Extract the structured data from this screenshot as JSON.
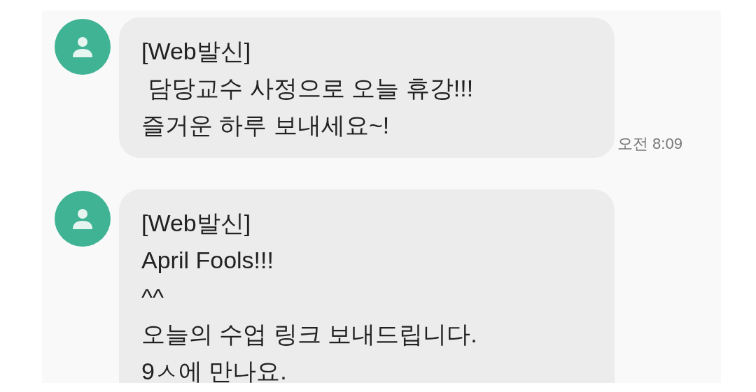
{
  "messages": [
    {
      "lines": [
        "[Web발신]",
        " 담당교수 사정으로 오늘 휴강!!!",
        "즐거운 하루 보내세요~!"
      ],
      "time": "오전 8:09"
    },
    {
      "lines": [
        "[Web발신]",
        "April Fools!!!",
        "^^",
        "오늘의 수업 링크 보내드립니다.",
        "9ㅅ에 만나요."
      ]
    }
  ]
}
